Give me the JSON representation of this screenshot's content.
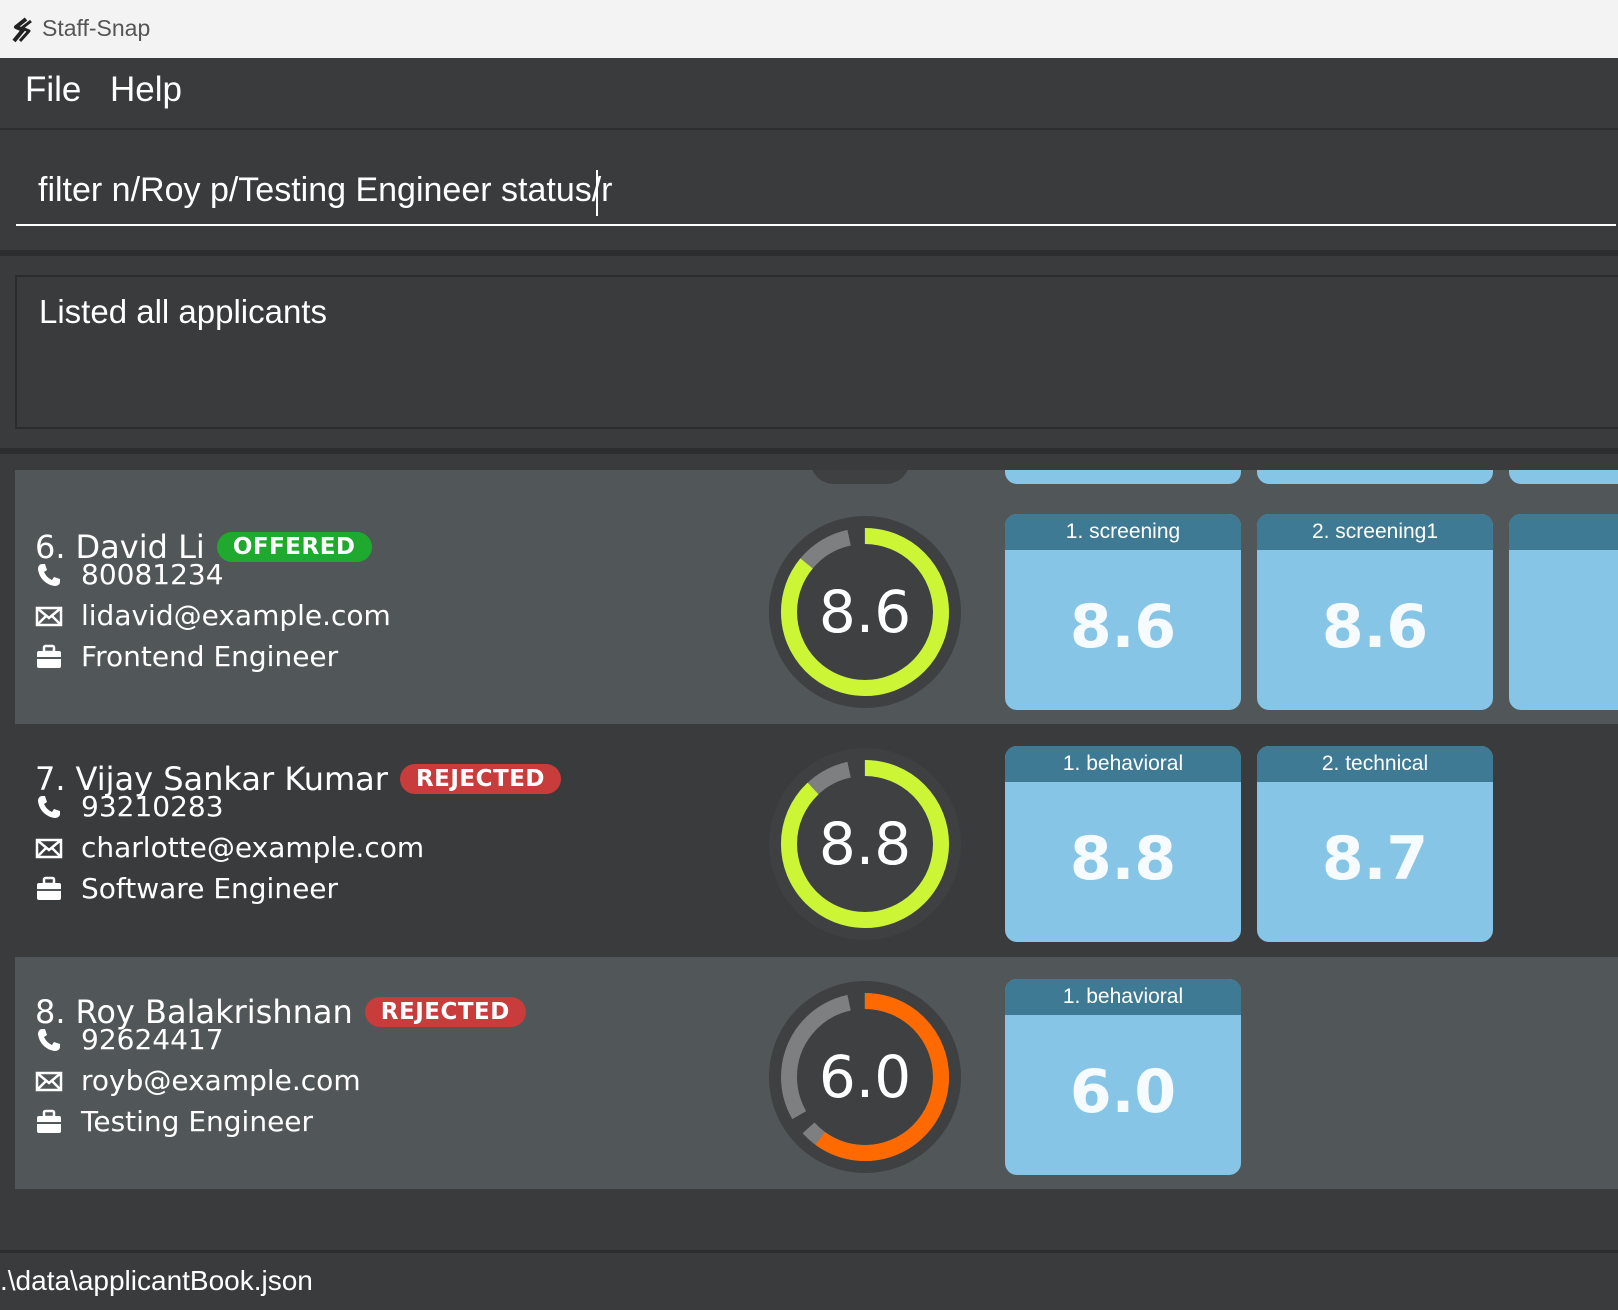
{
  "window": {
    "title": "Staff-Snap"
  },
  "menu": {
    "file": "File",
    "help": "Help"
  },
  "command": {
    "value": "filter n/Roy p/Testing Engineer status/r"
  },
  "result": {
    "text": "Listed all applicants"
  },
  "applicants": [
    {
      "index": "6.",
      "name": "David Li",
      "status": "OFFERED",
      "status_color": "#1faa2f",
      "phone": "80081234",
      "email": "lidavid@example.com",
      "position": "Frontend Engineer",
      "score": "8.6",
      "score_ratio": 0.86,
      "ring_color": "#ccf536",
      "interviews": [
        {
          "label": "1. screening",
          "score": "8.6"
        },
        {
          "label": "2. screening1",
          "score": "8.6"
        },
        {
          "label": "",
          "score": ""
        }
      ]
    },
    {
      "index": "7.",
      "name": "Vijay Sankar Kumar",
      "status": "REJECTED",
      "status_color": "#c83c3c",
      "phone": "93210283",
      "email": "charlotte@example.com",
      "position": "Software Engineer",
      "score": "8.8",
      "score_ratio": 0.88,
      "ring_color": "#ccf536",
      "interviews": [
        {
          "label": "1. behavioral",
          "score": "8.8"
        },
        {
          "label": "2. technical",
          "score": "8.7"
        }
      ]
    },
    {
      "index": "8.",
      "name": "Roy Balakrishnan",
      "status": "REJECTED",
      "status_color": "#c83c3c",
      "phone": "92624417",
      "email": "royb@example.com",
      "position": "Testing Engineer",
      "score": "6.0",
      "score_ratio": 0.6,
      "ring_color": "#ff6a00",
      "interviews": [
        {
          "label": "1. behavioral",
          "score": "6.0"
        }
      ]
    }
  ],
  "status_bar": {
    "path": ".\\data\\applicantBook.json"
  },
  "icons": {
    "phone": "phone-icon",
    "email": "envelope-icon",
    "position": "briefcase-icon"
  }
}
